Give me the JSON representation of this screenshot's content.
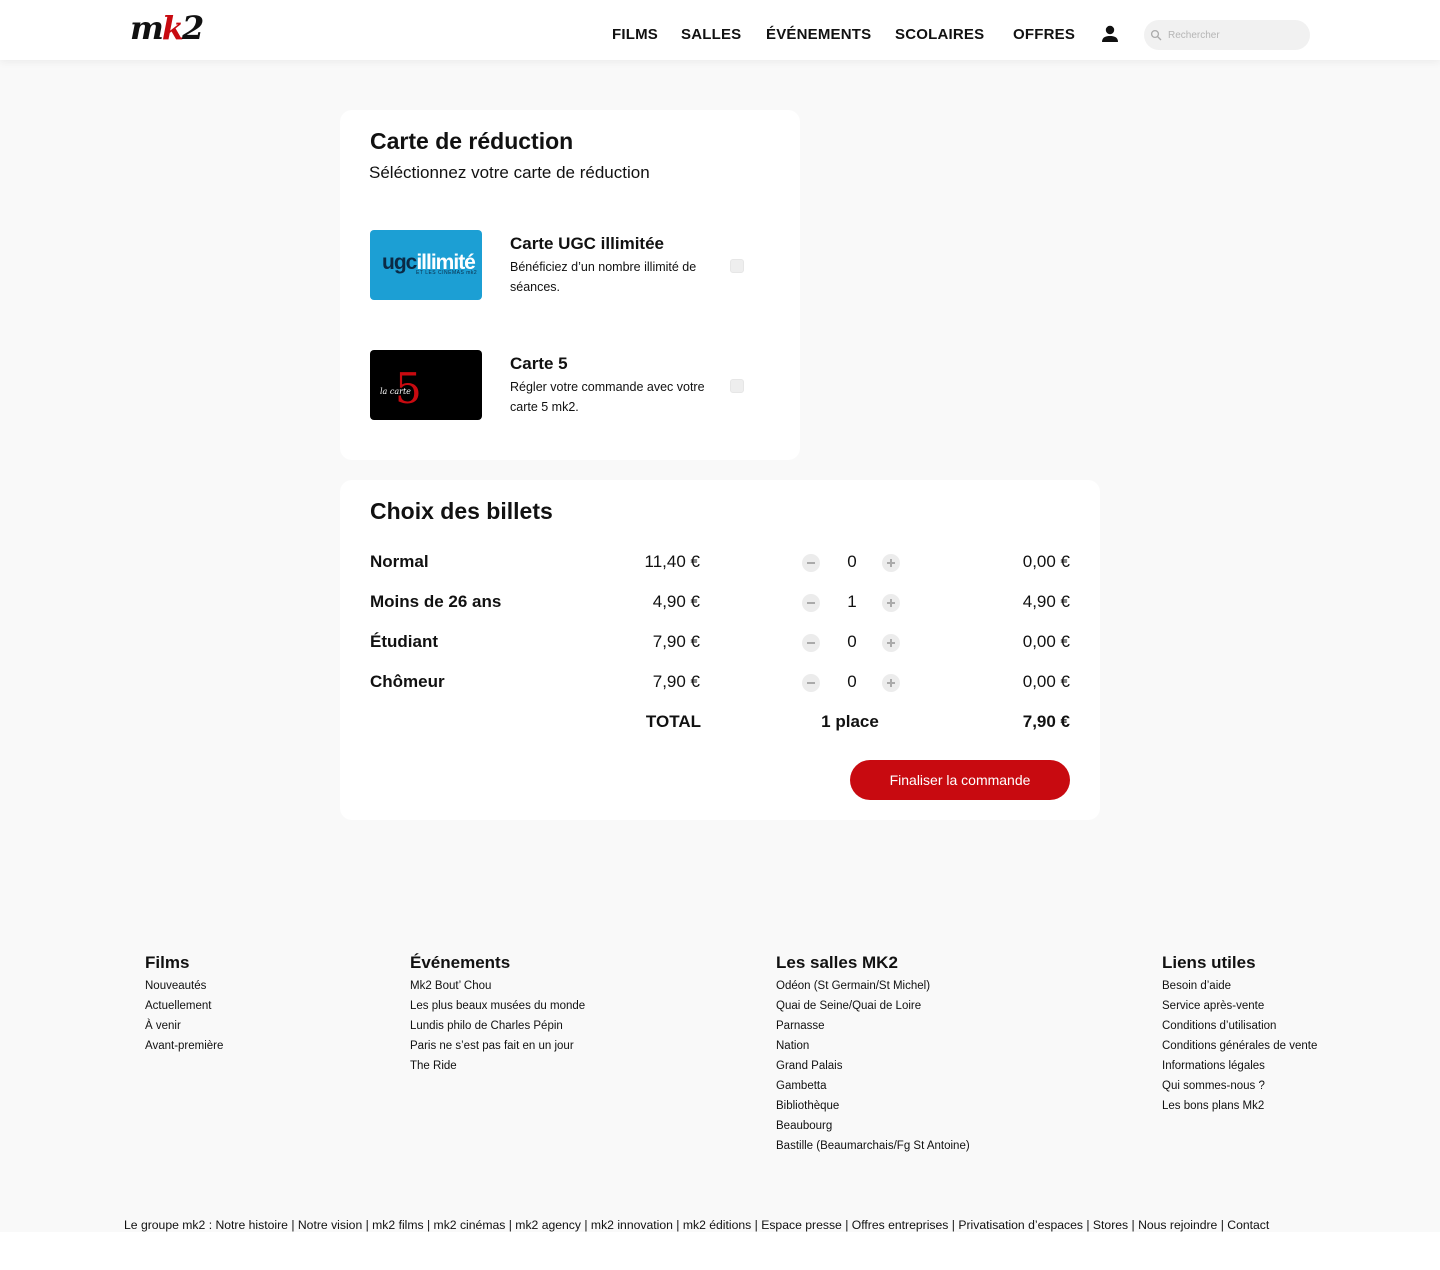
{
  "header": {
    "logo_m": "m",
    "logo_k": "k",
    "logo_2": "2",
    "nav": [
      "FILMS",
      "SALLES",
      "ÉVÉNEMENTS",
      "SCOLAIRES",
      "OFFRES"
    ],
    "search_placeholder": "Rechercher",
    "icons": {
      "account": "user-icon",
      "search": "search-icon"
    }
  },
  "reduction": {
    "title": "Carte de réduction",
    "subtitle": "Séléctionnez votre carte de réduction",
    "cards": [
      {
        "title": "Carte UGC illimitée",
        "desc": "Bénéficiez d’un nombre illimité de séances.",
        "thumb_text_1": "ugc",
        "thumb_text_2": "illimité",
        "thumb_small": "ET LES CINÉMAS mk2",
        "checked": false
      },
      {
        "title": "Carte 5",
        "desc": "Régler votre commande avec votre carte 5 mk2.",
        "thumb_text_1": "la carte",
        "thumb_text_2": "5",
        "checked": false
      }
    ]
  },
  "billets": {
    "title": "Choix des billets",
    "rows": [
      {
        "label": "Normal",
        "price": "11,40 €",
        "qty": "0",
        "subtotal": "0,00 €"
      },
      {
        "label": "Moins de 26 ans",
        "price": "4,90 €",
        "qty": "1",
        "subtotal": "4,90 €"
      },
      {
        "label": "Étudiant",
        "price": "7,90 €",
        "qty": "0",
        "subtotal": "0,00 €"
      },
      {
        "label": "Chômeur",
        "price": "7,90 €",
        "qty": "0",
        "subtotal": "0,00 €"
      }
    ],
    "total_label": "TOTAL",
    "total_places": "1 place",
    "total_amount": "7,90 €",
    "cta": "Finaliser la commande"
  },
  "footer": {
    "columns": [
      {
        "title": "Films",
        "items": [
          "Nouveautés",
          "Actuellement",
          "À venir",
          "Avant-première"
        ]
      },
      {
        "title": "Événements",
        "items": [
          "Mk2 Bout’ Chou",
          "Les plus beaux musées du monde",
          "Lundis philo de Charles Pépin",
          "Paris ne s’est pas fait en un jour",
          "The Ride"
        ]
      },
      {
        "title": "Les salles MK2",
        "items": [
          "Odéon (St Germain/St Michel)",
          "Quai de Seine/Quai de Loire",
          "Parnasse",
          "Nation",
          "Grand Palais",
          "Gambetta",
          "Bibliothèque",
          "Beaubourg",
          "Bastille (Beaumarchais/Fg St Antoine)"
        ]
      },
      {
        "title": "Liens utiles",
        "items": [
          "Besoin d’aide",
          "Service après-vente",
          "Conditions d’utilisation",
          "Conditions générales de vente",
          "Informations légales",
          "Qui sommes-nous ?",
          "Les bons plans Mk2"
        ]
      }
    ],
    "bottom_line": "Le groupe mk2 : Notre histoire | Notre vision | mk2 films | mk2 cinémas | mk2 agency | mk2 innovation | mk2 éditions | Espace presse | Offres entreprises | Privatisation d’espaces | Stores | Nous rejoindre | Contact"
  },
  "colors": {
    "accent": "#c80a10",
    "ugc_blue": "#1c9fd4",
    "page_bg": "#f9f9f9"
  }
}
